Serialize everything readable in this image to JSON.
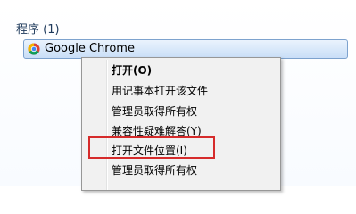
{
  "group": {
    "header": "程序 (1)"
  },
  "result": {
    "label": "Google Chrome",
    "icon": "chrome-icon"
  },
  "context_menu": {
    "items": [
      {
        "label": "打开(O)",
        "bold": true
      },
      {
        "label": "用记事本打开该文件",
        "bold": false
      },
      {
        "label": "管理员取得所有权",
        "bold": false
      },
      {
        "label": "兼容性疑难解答(Y)",
        "bold": false
      },
      {
        "label": "打开文件位置(I)",
        "bold": false,
        "highlighted": true
      },
      {
        "label": "管理员取得所有权",
        "bold": false
      }
    ]
  },
  "colors": {
    "accent": "#7da2ce",
    "highlight_outline": "#d62b2b",
    "header_text": "#1e395b"
  }
}
